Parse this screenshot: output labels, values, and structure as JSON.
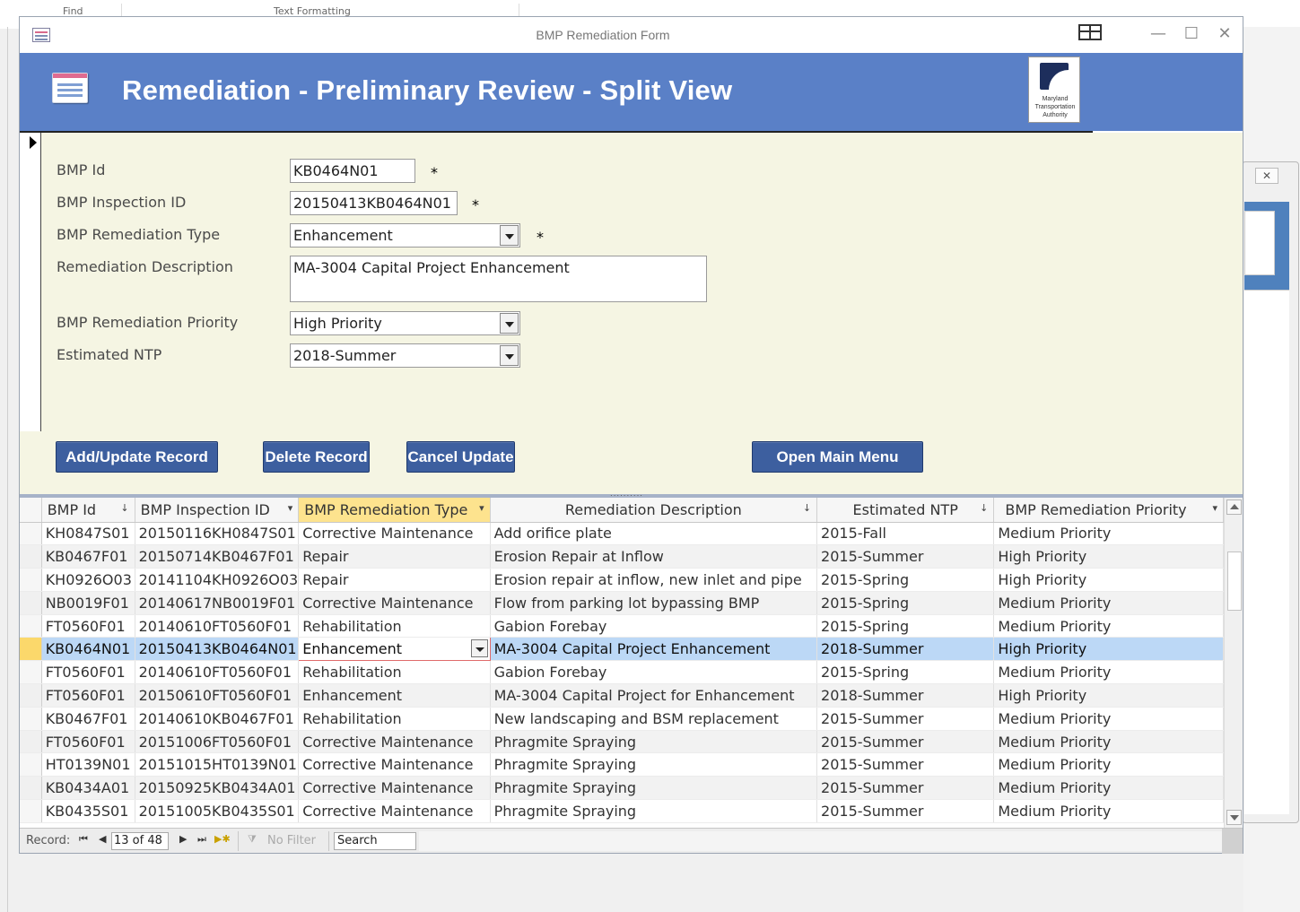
{
  "background_app": {
    "ribbon_fragments": [
      "Find",
      "Text Formatting"
    ]
  },
  "window": {
    "title": "BMP Remediation Form",
    "controls": {
      "minimize": "—",
      "maximize": "☐",
      "close": "✕"
    }
  },
  "header": {
    "title": "Remediation - Preliminary Review - Split View",
    "logo_lines": [
      "Maryland",
      "Transportation",
      "Authority"
    ]
  },
  "form": {
    "fields": [
      {
        "label": "BMP Id",
        "value": "KB0464N01",
        "required_mark": "*"
      },
      {
        "label": "BMP Inspection ID",
        "value": "20150413KB0464N01",
        "required_mark": "*"
      },
      {
        "label": "BMP Remediation Type",
        "value": "Enhancement",
        "required_mark": "*"
      },
      {
        "label": "Remediation Description",
        "value": "MA-3004 Capital Project Enhancement"
      },
      {
        "label": "BMP Remediation Priority",
        "value": "High Priority"
      },
      {
        "label": "Estimated NTP",
        "value": "2018-Summer"
      }
    ],
    "buttons": {
      "add_update": "Add/Update Record",
      "delete": "Delete Record",
      "cancel": "Cancel Update",
      "main_menu": "Open Main Menu"
    }
  },
  "grid": {
    "columns": [
      {
        "label": "BMP Id",
        "icon": "↓"
      },
      {
        "label": "BMP Inspection ID",
        "icon": "▾"
      },
      {
        "label": "BMP Remediation Type",
        "icon": "▾"
      },
      {
        "label": "Remediation Description",
        "icon": "↓"
      },
      {
        "label": "Estimated NTP",
        "icon": "↓"
      },
      {
        "label": "BMP Remediation Priority",
        "icon": "▾"
      }
    ],
    "rows": [
      [
        "KH0847S01",
        "20150116KH0847S01",
        "Corrective Maintenance",
        "Add orifice plate",
        "2015-Fall",
        "Medium Priority"
      ],
      [
        "KB0467F01",
        "20150714KB0467F01",
        "Repair",
        "Erosion Repair at Inflow",
        "2015-Summer",
        "High Priority"
      ],
      [
        "KH0926O03",
        "20141104KH0926O03",
        "Repair",
        "Erosion repair at inflow, new inlet and pipe",
        "2015-Spring",
        "High Priority"
      ],
      [
        "NB0019F01",
        "20140617NB0019F01",
        "Corrective Maintenance",
        "Flow from parking lot bypassing BMP",
        "2015-Spring",
        "Medium Priority"
      ],
      [
        "FT0560F01",
        "20140610FT0560F01",
        "Rehabilitation",
        "Gabion Forebay",
        "2015-Spring",
        "Medium Priority"
      ],
      [
        "KB0464N01",
        "20150413KB0464N01",
        "Enhancement",
        "MA-3004 Capital Project Enhancement",
        "2018-Summer",
        "High Priority"
      ],
      [
        "FT0560F01",
        "20140610FT0560F01",
        "Rehabilitation",
        "Gabion Forebay",
        "2015-Spring",
        "Medium Priority"
      ],
      [
        "FT0560F01",
        "20150610FT0560F01",
        "Enhancement",
        "MA-3004 Capital Project for Enhancement",
        "2018-Summer",
        "High Priority"
      ],
      [
        "KB0467F01",
        "20140610KB0467F01",
        "Rehabilitation",
        "New landscaping and BSM replacement",
        "2015-Summer",
        "Medium Priority"
      ],
      [
        "FT0560F01",
        "20151006FT0560F01",
        "Corrective Maintenance",
        "Phragmite Spraying",
        "2015-Summer",
        "Medium Priority"
      ],
      [
        "HT0139N01",
        "20151015HT0139N01",
        "Corrective Maintenance",
        "Phragmite Spraying",
        "2015-Summer",
        "Medium Priority"
      ],
      [
        "KB0434A01",
        "20150925KB0434A01",
        "Corrective Maintenance",
        "Phragmite Spraying",
        "2015-Summer",
        "Medium Priority"
      ],
      [
        "KB0435S01",
        "20151005KB0435S01",
        "Corrective Maintenance",
        "Phragmite Spraying",
        "2015-Summer",
        "Medium Priority"
      ]
    ]
  },
  "navbar": {
    "record_label": "Record:",
    "record_position": "13 of 48",
    "no_filter": "No Filter",
    "search": "Search"
  },
  "colors": {
    "header_bg": "#5a80c7",
    "button_bg": "#3d5f9f",
    "detail_bg": "#f5f5e3",
    "current_row": "#bcd8f6",
    "active_column": "#fde38e"
  }
}
